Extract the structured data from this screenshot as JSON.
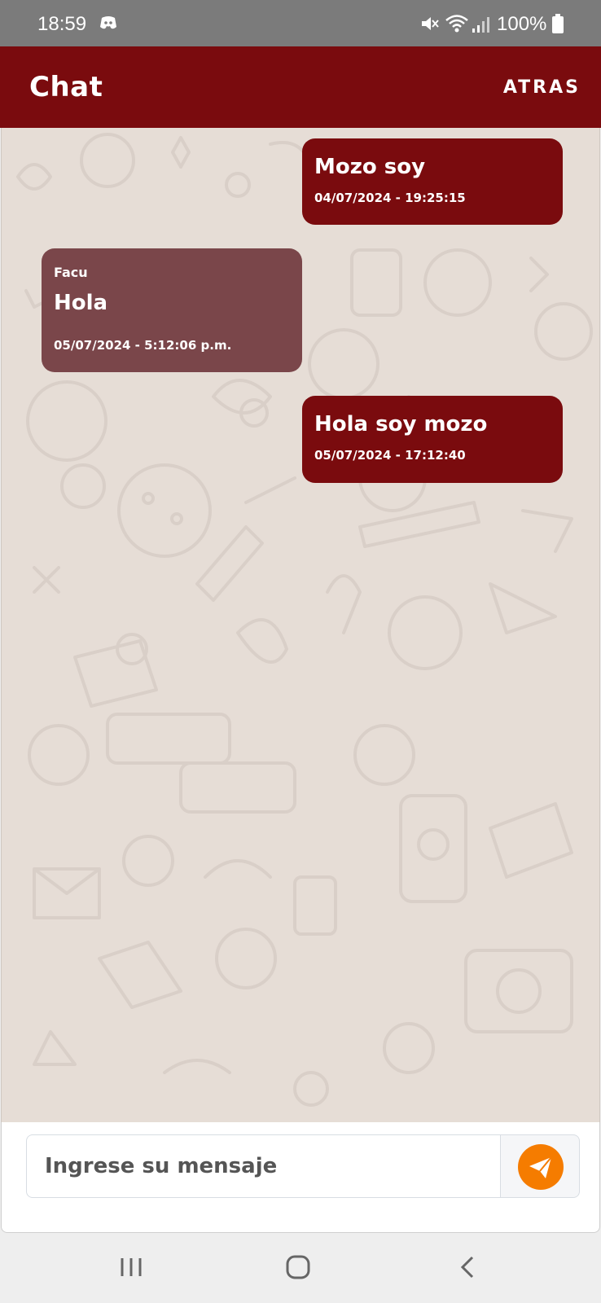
{
  "status_bar": {
    "time": "18:59",
    "battery": "100%",
    "icons": [
      "discord-icon",
      "mute-icon",
      "wifi-icon",
      "signal-icon",
      "battery-icon"
    ]
  },
  "header": {
    "title": "Chat",
    "back_label": "ATRAS",
    "background": "#7a0b0e"
  },
  "messages": [
    {
      "own": true,
      "text": "Mozo soy",
      "time": "04/07/2024 - 19:25:15"
    },
    {
      "own": false,
      "sender": "Facu",
      "text": "Hola",
      "time": "05/07/2024 - 5:12:06 p.m."
    },
    {
      "own": true,
      "text": "Hola soy mozo",
      "time": "05/07/2024 - 17:12:40"
    }
  ],
  "composer": {
    "placeholder": "Ingrese su mensaje",
    "send_icon": "send-icon",
    "send_color": "#f57c00"
  },
  "colors": {
    "own_bubble": "#7a0b0e",
    "other_bubble": "#7a464a",
    "chat_background": "#e6ddd6"
  },
  "nav_bar": {
    "icons": [
      "recent-apps-icon",
      "home-icon",
      "back-icon"
    ]
  }
}
